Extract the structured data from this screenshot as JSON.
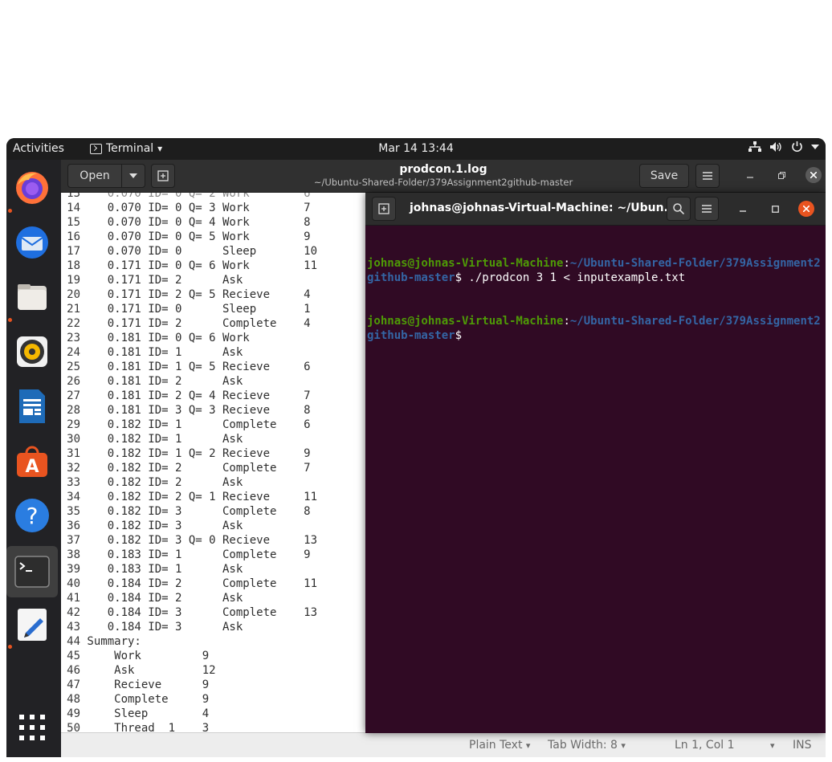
{
  "topbar": {
    "activities": "Activities",
    "app_name": "Terminal",
    "app_arrow": "▾",
    "clock": "Mar 14  13:44",
    "tray_icons": [
      "network-icon",
      "volume-icon",
      "power-icon",
      "chevron-down-icon"
    ]
  },
  "dock": {
    "items": [
      "firefox-icon",
      "thunderbird-icon",
      "files-icon",
      "rhythmbox-icon",
      "libreoffice-writer-icon",
      "ubuntu-software-icon",
      "help-icon",
      "terminal-icon",
      "text-editor-icon",
      "show-applications-icon"
    ]
  },
  "gedit": {
    "open_label": "Open",
    "title": "prodcon.1.log",
    "subtitle": "~/Ubuntu-Shared-Folder/379Assignment2github-master",
    "save_label": "Save",
    "lines": [
      {
        "n": "14",
        "t": "    0.070 ID= 0 Q= 3 Work        7"
      },
      {
        "n": "15",
        "t": "    0.070 ID= 0 Q= 4 Work        8"
      },
      {
        "n": "16",
        "t": "    0.070 ID= 0 Q= 5 Work        9"
      },
      {
        "n": "17",
        "t": "    0.070 ID= 0      Sleep       10"
      },
      {
        "n": "18",
        "t": "    0.171 ID= 0 Q= 6 Work        11"
      },
      {
        "n": "19",
        "t": "    0.171 ID= 2      Ask"
      },
      {
        "n": "20",
        "t": "    0.171 ID= 2 Q= 5 Recieve     4"
      },
      {
        "n": "21",
        "t": "    0.171 ID= 0      Sleep       1"
      },
      {
        "n": "22",
        "t": "    0.171 ID= 2      Complete    4"
      },
      {
        "n": "23",
        "t": "    0.181 ID= 0 Q= 6 Work"
      },
      {
        "n": "24",
        "t": "    0.181 ID= 1      Ask"
      },
      {
        "n": "25",
        "t": "    0.181 ID= 1 Q= 5 Recieve     6"
      },
      {
        "n": "26",
        "t": "    0.181 ID= 2      Ask"
      },
      {
        "n": "27",
        "t": "    0.181 ID= 2 Q= 4 Recieve     7"
      },
      {
        "n": "28",
        "t": "    0.181 ID= 3 Q= 3 Recieve     8"
      },
      {
        "n": "29",
        "t": "    0.182 ID= 1      Complete    6"
      },
      {
        "n": "30",
        "t": "    0.182 ID= 1      Ask"
      },
      {
        "n": "31",
        "t": "    0.182 ID= 1 Q= 2 Recieve     9"
      },
      {
        "n": "32",
        "t": "    0.182 ID= 2      Complete    7"
      },
      {
        "n": "33",
        "t": "    0.182 ID= 2      Ask"
      },
      {
        "n": "34",
        "t": "    0.182 ID= 2 Q= 1 Recieve     11"
      },
      {
        "n": "35",
        "t": "    0.182 ID= 3      Complete    8"
      },
      {
        "n": "36",
        "t": "    0.182 ID= 3      Ask"
      },
      {
        "n": "37",
        "t": "    0.182 ID= 3 Q= 0 Recieve     13"
      },
      {
        "n": "38",
        "t": "    0.183 ID= 1      Complete    9"
      },
      {
        "n": "39",
        "t": "    0.183 ID= 1      Ask"
      },
      {
        "n": "40",
        "t": "    0.184 ID= 2      Complete    11"
      },
      {
        "n": "41",
        "t": "    0.184 ID= 2      Ask"
      },
      {
        "n": "42",
        "t": "    0.184 ID= 3      Complete    13"
      },
      {
        "n": "43",
        "t": "    0.184 ID= 3      Ask"
      },
      {
        "n": "44",
        "t": " Summary:"
      },
      {
        "n": "45",
        "t": "     Work         9"
      },
      {
        "n": "46",
        "t": "     Ask          12"
      },
      {
        "n": "47",
        "t": "     Recieve      9"
      },
      {
        "n": "48",
        "t": "     Complete     9"
      },
      {
        "n": "49",
        "t": "     Sleep        4"
      },
      {
        "n": "50",
        "t": "     Thread  1    3"
      }
    ],
    "status": {
      "language": "Plain Text",
      "tab_width": "Tab Width: 8",
      "position": "Ln 1, Col 1",
      "mode": "INS"
    }
  },
  "terminal": {
    "title": "johnas@johnas-Virtual-Machine: ~/Ubun...",
    "lines": [
      {
        "user": "johnas@johnas-Virtual-Machine",
        "sep": ":",
        "path": "~/Ubuntu-Shared-Folder/379Assignment2github-master",
        "cmd": "$ ./prodcon 3 1 < inputexample.txt"
      },
      {
        "user": "johnas@johnas-Virtual-Machine",
        "sep": ":",
        "path": "~/Ubuntu-Shared-Folder/379Assignment2github-master",
        "cmd": "$"
      }
    ]
  },
  "colors": {
    "terminal_bg": "#300a24",
    "prompt_user": "#4e9a06",
    "prompt_path": "#3465a4",
    "accent": "#e95420"
  }
}
